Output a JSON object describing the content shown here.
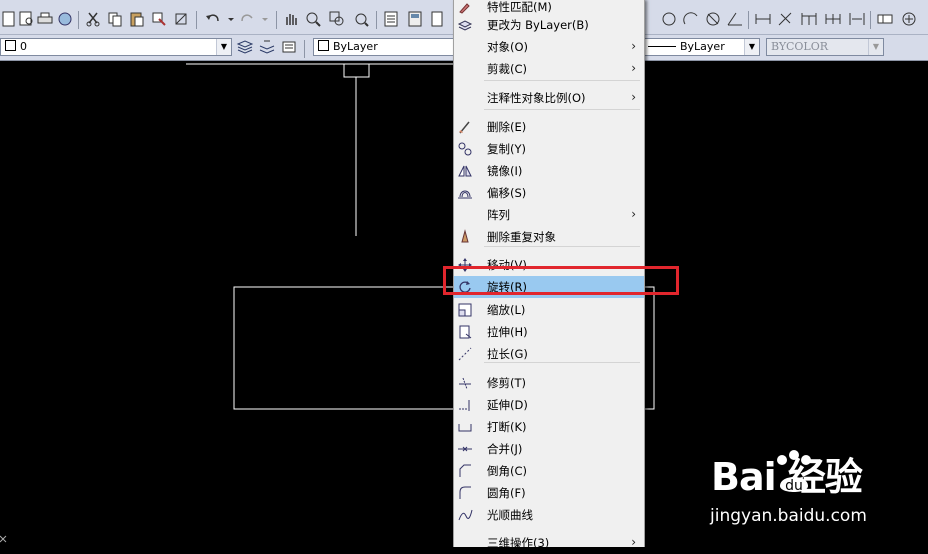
{
  "toolbar": {
    "layer_value": "0",
    "color_value": "ByLayer",
    "linetype_value": "ByLayer",
    "plotstyle_value": "BYCOLOR"
  },
  "context_menu": {
    "items": [
      {
        "key": "partial",
        "label": "特性匹配(M)",
        "icon": "brush-icon"
      },
      {
        "key": "change_bylayer",
        "label": "更改为 ByLayer(B)",
        "icon": "bylayer-icon"
      },
      {
        "key": "object",
        "label": "对象(O)",
        "submenu": "›"
      },
      {
        "key": "clip",
        "label": "剪裁(C)",
        "submenu": "›"
      },
      {
        "key": "annot_scale",
        "label": "注释性对象比例(O)",
        "submenu": "›"
      },
      {
        "key": "erase",
        "label": "删除(E)",
        "icon": "erase-icon"
      },
      {
        "key": "copy",
        "label": "复制(Y)",
        "icon": "copy-icon"
      },
      {
        "key": "mirror",
        "label": "镜像(I)",
        "icon": "mirror-icon"
      },
      {
        "key": "offset",
        "label": "偏移(S)",
        "icon": "offset-icon"
      },
      {
        "key": "array",
        "label": "阵列",
        "submenu": "›"
      },
      {
        "key": "overkill",
        "label": "删除重复对象",
        "icon": "overkill-icon"
      },
      {
        "key": "move",
        "label": "移动(V)",
        "icon": "move-icon"
      },
      {
        "key": "rotate",
        "label": "旋转(R)",
        "icon": "rotate-icon"
      },
      {
        "key": "scale",
        "label": "缩放(L)",
        "icon": "scale-icon"
      },
      {
        "key": "stretch",
        "label": "拉伸(H)",
        "icon": "stretch-icon"
      },
      {
        "key": "lengthen",
        "label": "拉长(G)",
        "icon": "lengthen-icon"
      },
      {
        "key": "trim",
        "label": "修剪(T)",
        "icon": "trim-icon"
      },
      {
        "key": "extend",
        "label": "延伸(D)",
        "icon": "extend-icon"
      },
      {
        "key": "break",
        "label": "打断(K)",
        "icon": "break-icon"
      },
      {
        "key": "join",
        "label": "合并(J)",
        "icon": "join-icon"
      },
      {
        "key": "chamfer",
        "label": "倒角(C)",
        "icon": "chamfer-icon"
      },
      {
        "key": "fillet",
        "label": "圆角(F)",
        "icon": "fillet-icon"
      },
      {
        "key": "blend",
        "label": "光顺曲线",
        "icon": "blend-icon"
      },
      {
        "key": "3d_ops",
        "label": "三维操作(3)",
        "submenu": "›"
      }
    ]
  },
  "watermark": {
    "logo": "Bai  经验",
    "url": "jingyan.baidu.com"
  },
  "colors": {
    "highlight": "#99c9f0",
    "annotation_box": "#e1262d",
    "toolbar_bg": "#d6dbe9"
  }
}
